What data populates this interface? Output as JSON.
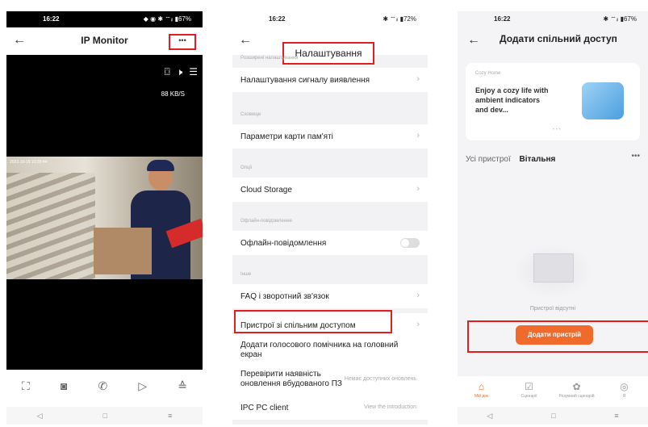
{
  "phone1": {
    "status_time": "16:22",
    "status_sys": "◆ ◉ ✱ ⌔ᵢₗ ▮67%",
    "title": "IP Monitor",
    "more": "•••",
    "speed": "88 KB/S",
    "timestamp": "2023-10-19 10:35:44",
    "top_icons": [
      "camera-icon",
      "speaker-muted-icon",
      "menu-icon"
    ],
    "controls": [
      "⛶",
      "◙",
      "✆",
      "▷",
      "≙"
    ],
    "sysnav": [
      "◁",
      "□",
      "≡"
    ]
  },
  "phone2": {
    "status_time": "16:22",
    "status_sys": "✱ ⌔ᵢₗ ▮72%",
    "title": "Налаштування",
    "sections": {
      "s1": "Розширені налаштування",
      "s2": "Сховище",
      "s3": "Опції",
      "s4": "Офлайн-повідомлення",
      "s5": "Інше"
    },
    "rows": {
      "detect": "Налаштування сигналу виявлення",
      "memory": "Параметри карти пам'яті",
      "cloud": "Cloud Storage",
      "offline": "Офлайн-повідомлення",
      "faq": "FAQ і зворотний зв'язок",
      "shared": "Пристрої зі спільним доступом",
      "voice": "Додати голосового помічника на головний екран",
      "update": "Перевірити наявність оновлення вбудованого ПЗ",
      "update_note": "Немає доступних оновлень",
      "ipc": "IPC PC client",
      "ipc_note": "View the introduction"
    }
  },
  "phone3": {
    "status_time": "16:22",
    "status_sys": "✱ ⌔ᵢₗ ▮67%",
    "title": "Додати спільний доступ",
    "banner_small": "Cozy Home",
    "banner_text": "Enjoy a cozy life with ambient indicators and dev...",
    "tabs": [
      "Усі пристрої",
      "Вітальня"
    ],
    "empty": "Пристрої відсутні",
    "add_btn": "Додати пристрій",
    "tabbar": [
      {
        "icon": "⌂",
        "label": "Мій дім"
      },
      {
        "icon": "☑",
        "label": "Сценарії"
      },
      {
        "icon": "✿",
        "label": "Розумний сценарій"
      },
      {
        "icon": "◎",
        "label": "Я"
      }
    ],
    "accent": "#f06a2c"
  }
}
